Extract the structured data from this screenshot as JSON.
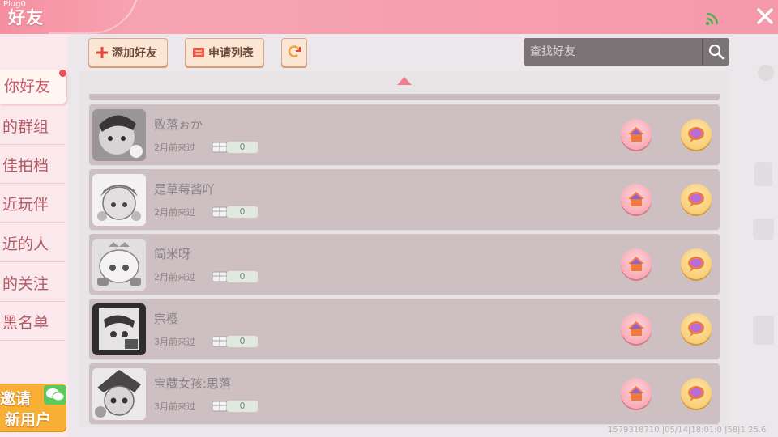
{
  "header": {
    "brand": "Plug0",
    "title": "好友",
    "icons": {
      "signal": "signal-icon",
      "close": "close-icon"
    }
  },
  "sidebar": {
    "items": [
      {
        "label": "你好友",
        "active": true
      },
      {
        "label": "的群组",
        "active": false
      },
      {
        "label": "佳拍档",
        "active": false
      },
      {
        "label": "近玩伴",
        "active": false
      },
      {
        "label": "近的人",
        "active": false
      },
      {
        "label": "的关注",
        "active": false
      },
      {
        "label": "黑名单",
        "active": false
      }
    ],
    "invite": {
      "line1": "邀请",
      "line2": "新用户"
    }
  },
  "toolbar": {
    "add_friend": "添加好友",
    "request_list": "申请列表",
    "refresh_icon": "refresh-icon"
  },
  "search": {
    "placeholder": "查找好友",
    "icon": "search-icon"
  },
  "friends": [
    {
      "name": "败落ぉか",
      "last_seen": "2月前来过",
      "gifts": "0"
    },
    {
      "name": "是草莓酱吖",
      "last_seen": "2月前来过",
      "gifts": "0"
    },
    {
      "name": "简米呀",
      "last_seen": "2月前来过",
      "gifts": "0"
    },
    {
      "name": "宗樱",
      "last_seen": "3月前来过",
      "gifts": "0"
    },
    {
      "name": "宝藏女孩:思落",
      "last_seen": "3月前来过",
      "gifts": "0"
    }
  ],
  "debug_text": "1579318710   |05/14|18:01:0   |58|1 25.6",
  "colors": {
    "header": "#f59aab",
    "sidebar_bg": "#fbe8ec",
    "accent_red": "#ef4d5a",
    "invite": "#f7b033",
    "row_bg": "#cdbfc2"
  }
}
